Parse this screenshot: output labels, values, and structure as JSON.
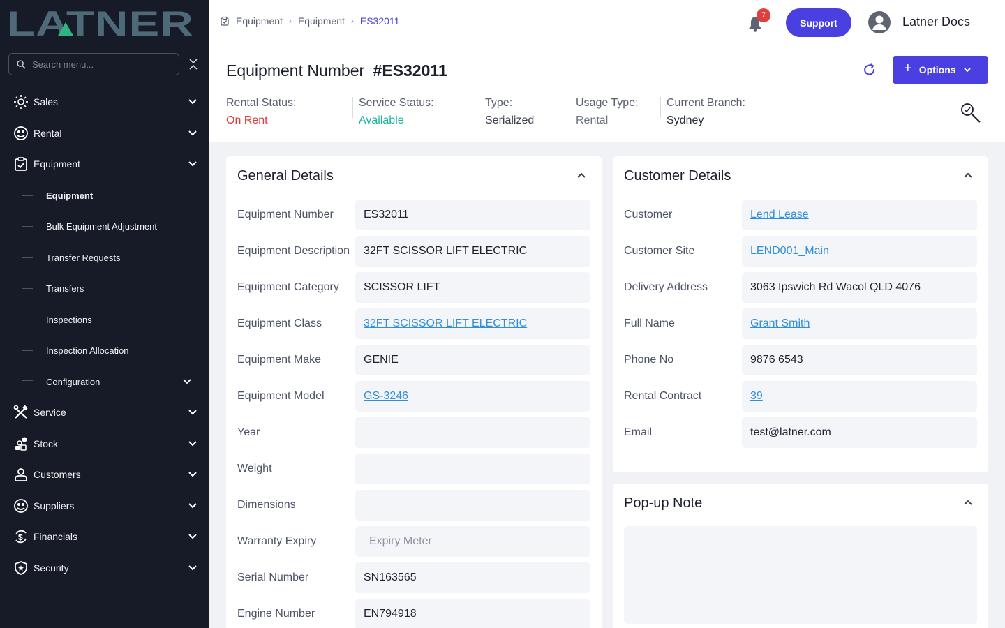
{
  "app": {
    "logo_text": "LATNER"
  },
  "sidebar": {
    "search_placeholder": "Search menu...",
    "items": [
      {
        "label": "Sales",
        "icon": "sales-icon"
      },
      {
        "label": "Rental",
        "icon": "rental-icon"
      },
      {
        "label": "Equipment",
        "icon": "equipment-icon"
      },
      {
        "label": "Service",
        "icon": "service-icon"
      },
      {
        "label": "Stock",
        "icon": "stock-icon"
      },
      {
        "label": "Customers",
        "icon": "customers-icon"
      },
      {
        "label": "Suppliers",
        "icon": "suppliers-icon"
      },
      {
        "label": "Financials",
        "icon": "financials-icon"
      },
      {
        "label": "Security",
        "icon": "security-icon"
      }
    ],
    "equipment_sub": [
      "Equipment",
      "Bulk Equipment Adjustment",
      "Transfer Requests",
      "Transfers",
      "Inspections",
      "Inspection Allocation",
      "Configuration"
    ]
  },
  "topbar": {
    "breadcrumbs": [
      "Equipment",
      "Equipment",
      "ES32011"
    ],
    "notifications": "7",
    "support": "Support",
    "user": "Latner Docs"
  },
  "header": {
    "title_label": "Equipment Number",
    "title_value": "#ES32011",
    "options": "Options",
    "statuses": [
      {
        "label": "Rental Status:",
        "value": "On Rent",
        "color": "#e23b3b"
      },
      {
        "label": "Service Status:",
        "value": "Available",
        "color": "#17b59a"
      },
      {
        "label": "Type:",
        "value": "Serialized",
        "color": "#3a3f4d"
      },
      {
        "label": "Usage Type:",
        "value": "Rental",
        "color": "#6b7180"
      },
      {
        "label": "Current Branch:",
        "value": "Sydney",
        "color": "#2a2f3c"
      }
    ]
  },
  "general": {
    "title": "General Details",
    "rows": [
      {
        "label": "Equipment Number",
        "value": "ES32011"
      },
      {
        "label": "Equipment Description",
        "value": "32FT SCISSOR LIFT ELECTRIC"
      },
      {
        "label": "Equipment Category",
        "value": "SCISSOR LIFT"
      },
      {
        "label": "Equipment Class",
        "value": "32FT SCISSOR LIFT ELECTRIC",
        "link": true
      },
      {
        "label": "Equipment Make",
        "value": "GENIE"
      },
      {
        "label": "Equipment Model",
        "value": "GS-3246",
        "link": true
      },
      {
        "label": "Year",
        "value": ""
      },
      {
        "label": "Weight",
        "value": ""
      },
      {
        "label": "Dimensions",
        "value": ""
      },
      {
        "label": "Warranty Expiry",
        "value": "",
        "placeholder": "Expiry Meter"
      },
      {
        "label": "Serial Number",
        "value": "SN163565"
      },
      {
        "label": "Engine Number",
        "value": "EN794918"
      }
    ]
  },
  "customer": {
    "title": "Customer Details",
    "rows": [
      {
        "label": "Customer",
        "value": "Lend Lease",
        "link": true
      },
      {
        "label": "Customer Site",
        "value": "LEND001_Main",
        "link": true
      },
      {
        "label": "Delivery Address",
        "value": "3063 Ipswich Rd Wacol QLD 4076"
      },
      {
        "label": "Full Name",
        "value": "Grant Smith",
        "link": true
      },
      {
        "label": "Phone No",
        "value": "9876 6543"
      },
      {
        "label": "Rental Contract",
        "value": "39",
        "link": true
      },
      {
        "label": "Email",
        "value": "test@latner.com"
      }
    ]
  },
  "popup": {
    "title": "Pop-up Note",
    "value": ""
  },
  "colors": {
    "accent": "#4a3fe0",
    "sidebar_bg": "#161b27",
    "link": "#2f8fdc",
    "logo": "#4e6a78",
    "logo_accent": "#2fb583"
  }
}
